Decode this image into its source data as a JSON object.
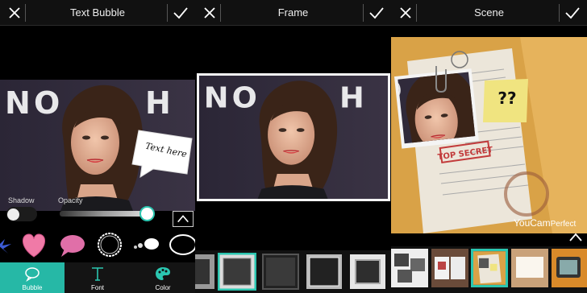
{
  "panels": {
    "text_bubble": {
      "title": "Text Bubble",
      "bubble_text": "Text here",
      "shadow_label": "Shadow",
      "opacity_label": "Opacity",
      "tabs": [
        {
          "label": "Bubble",
          "icon": "speech-bubble-icon",
          "active": true
        },
        {
          "label": "Font",
          "icon": "font-t-icon",
          "active": false
        },
        {
          "label": "Color",
          "icon": "palette-icon",
          "active": false
        }
      ],
      "stickers": [
        "blue-splash",
        "heart",
        "pink-speech",
        "circle-scribble",
        "cloud-dots",
        "ellipse-outline"
      ]
    },
    "frame": {
      "title": "Frame",
      "frames": [
        "partial",
        "teal-selected",
        "dark-square",
        "beveled",
        "silver-border"
      ]
    },
    "scene": {
      "title": "Scene",
      "note_text": "??",
      "brand_name": "YouCam",
      "brand_suffix": "Perfect",
      "scenes": [
        "bw-photos",
        "open-book",
        "documents-selected",
        "paper-sheet",
        "tv-frame"
      ]
    }
  },
  "colors": {
    "accent": "#26b8a6",
    "background": "#000000"
  }
}
